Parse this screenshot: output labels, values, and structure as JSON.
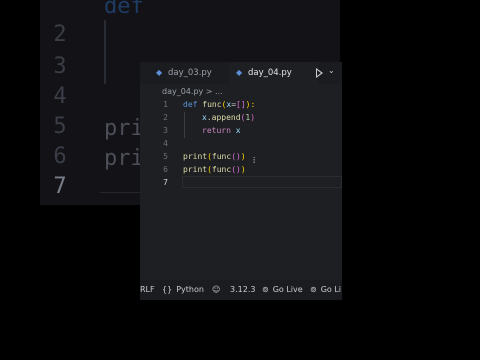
{
  "background": {
    "line_numbers": [
      "2",
      "3",
      "4",
      "5",
      "6",
      "7"
    ],
    "code_top": "def",
    "code_lines": [
      "prin",
      "pri"
    ]
  },
  "tabs": [
    {
      "label": "day_03.py"
    },
    {
      "label": "day_04.py"
    }
  ],
  "breadcrumb": "day_04.py > ...",
  "editor": {
    "line_numbers": [
      "1",
      "2",
      "3",
      "4",
      "5",
      "6",
      "7"
    ],
    "line1": {
      "kw": "def",
      "name": "func",
      "open": "(",
      "param": "x",
      "eq": "=",
      "list": "[]",
      "close": "):"
    },
    "line2": {
      "obj": "x",
      "method": ".append",
      "open": "(",
      "num": "1",
      "close": ")"
    },
    "line3": {
      "kw": "return",
      "var": "x"
    },
    "line5": {
      "fn": "print",
      "open": "(",
      "inner": "func",
      "inner_parens": "()",
      "close": ")"
    },
    "line6": {
      "fn": "print",
      "open": "(",
      "inner": "func",
      "inner_parens": "()",
      "close": ")"
    }
  },
  "status": {
    "eol": "RLF",
    "language": "Python",
    "version": "3.12.3",
    "go_live_1": "Go Live",
    "go_live_2": "Go Li"
  },
  "colors": {
    "editor_bg": "#1e1f22",
    "keyword": "#5b93d6",
    "function": "#dcdcaa",
    "variable": "#9cdcfe",
    "number": "#b5cea8"
  }
}
